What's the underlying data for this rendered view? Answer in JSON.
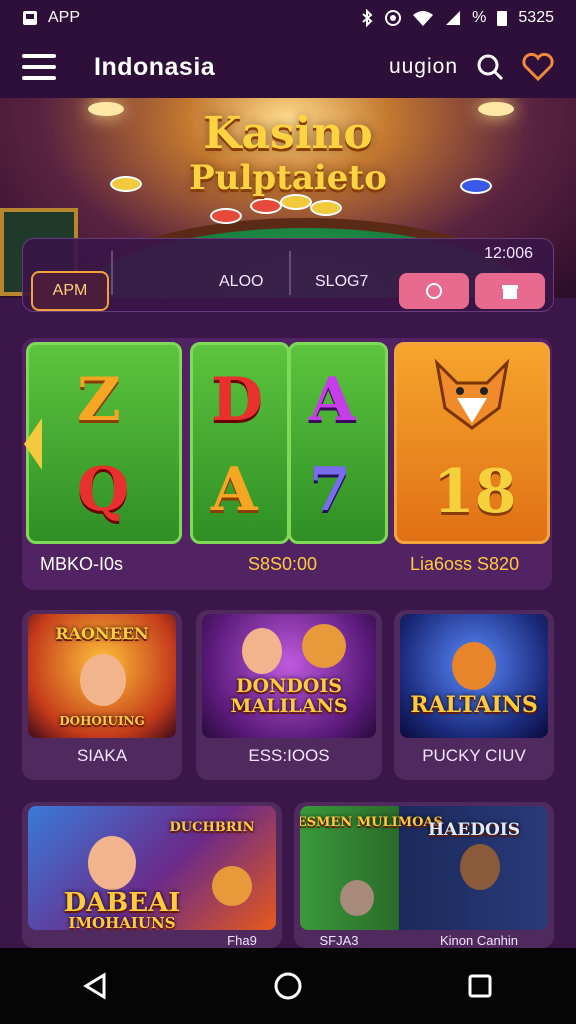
{
  "status_bar": {
    "app_label": "APP",
    "time": "5325",
    "battery": "%"
  },
  "header": {
    "title": "Indonasia",
    "link": "uugion",
    "icons": [
      "menu-icon",
      "search-icon",
      "heart-icon"
    ]
  },
  "hero": {
    "title_line1": "Kasino",
    "title_line2": "Pulptaieto",
    "apm_button": "APM",
    "tabs": [
      "ALOO",
      "SLOG7"
    ],
    "balance": "12:006"
  },
  "slots": {
    "reel1_symbols": [
      "Z",
      "Q"
    ],
    "reel2_symbols": [
      "D",
      "A"
    ],
    "reel3_symbols": [
      "A",
      "7"
    ],
    "feature_badge": "18",
    "label_left": "MBKO-I0s",
    "label_center": "S8S0:00",
    "label_right": "Lia6oss S820"
  },
  "game_cards": [
    {
      "title": "RAONEEN",
      "subtitle": "DOHOIUING",
      "label": "SIAKA"
    },
    {
      "title": "DONDOIS MALILANS",
      "subtitle": "",
      "label": "ESS:IOOS"
    },
    {
      "title": "RALTAINS",
      "subtitle": "",
      "label": "PUCKY CIUV"
    },
    {
      "title": "DABEAI",
      "subtitle": "IMOHAIUNS",
      "extra": "DUCHBRIN",
      "label": "Fha9"
    },
    {
      "title": "SHESMEN MULIMOAS",
      "subtitle": "HAEDOIS",
      "label": "SFJA3",
      "label2": "Kinon Canhin"
    }
  ],
  "colors": {
    "bg": "#3a1748",
    "accent": "#ffcb3d",
    "pink": "#e86a8f",
    "green": "#7ed957"
  },
  "nav_bar": {
    "icons": [
      "back-icon",
      "home-icon",
      "recents-icon"
    ]
  }
}
